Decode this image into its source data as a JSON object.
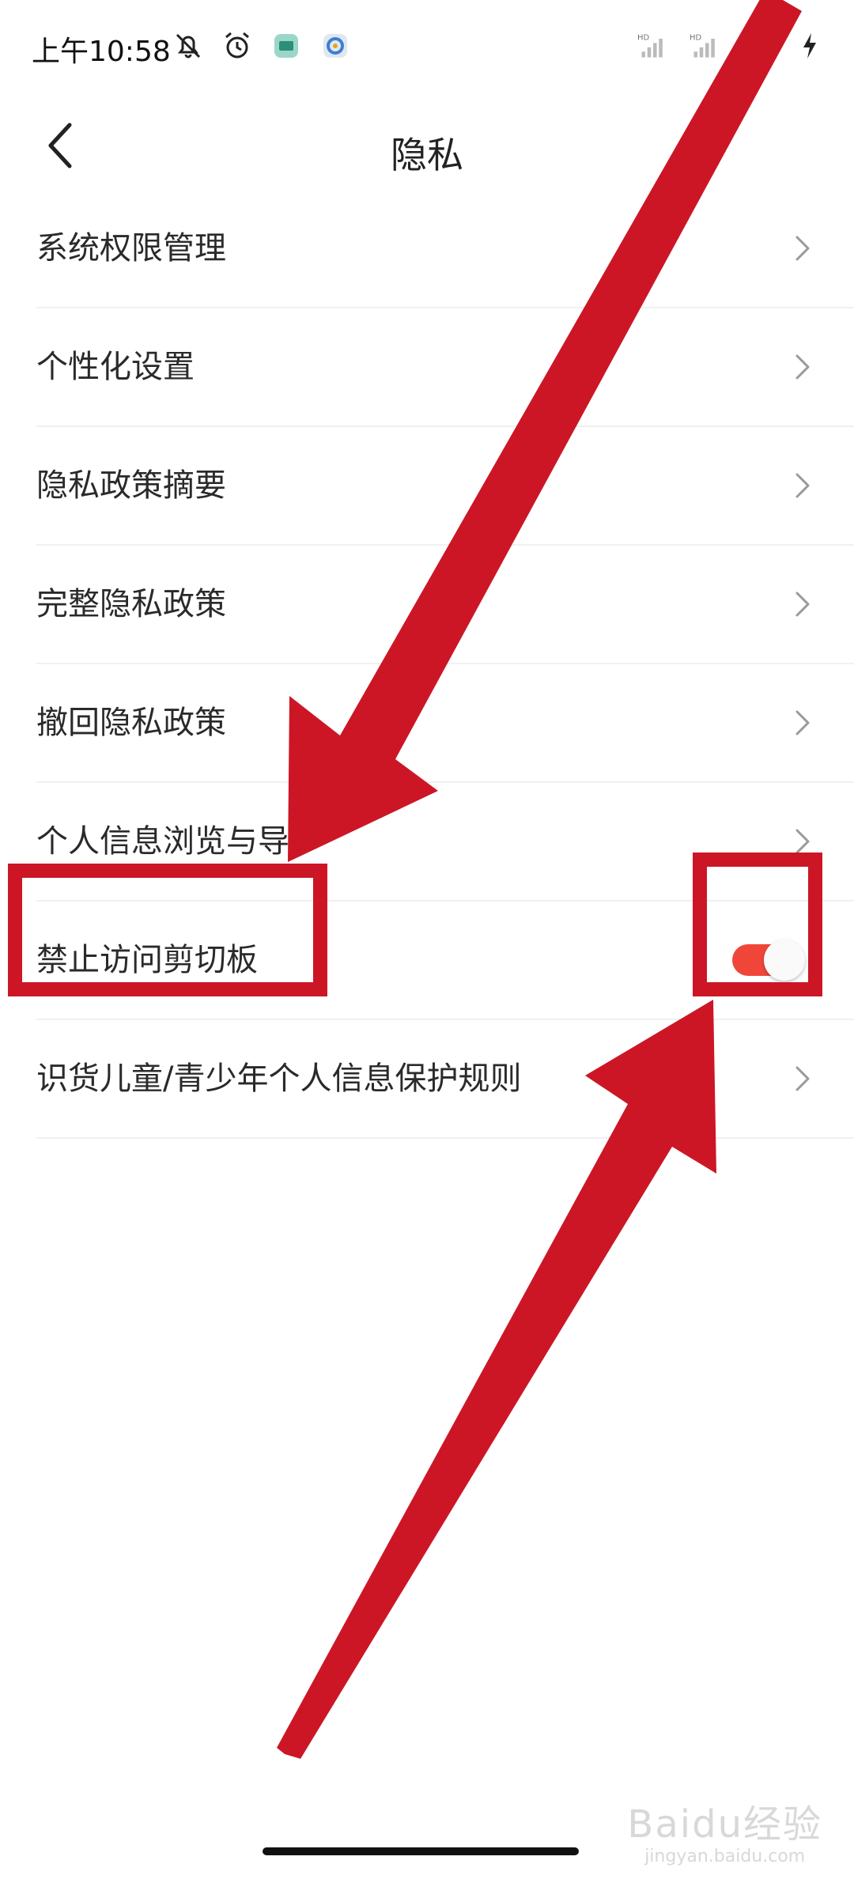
{
  "status_bar": {
    "time": "上午10:58",
    "icons_left": [
      "bell-off-icon",
      "alarm-icon",
      "app-notification-icon",
      "app-notification-icon"
    ],
    "icons_right": [
      "signal-hd-icon",
      "signal-hd-icon",
      "wifi-icon",
      "battery-charging-icon"
    ]
  },
  "header": {
    "title": "隐私",
    "back_icon": "chevron-left-icon"
  },
  "menu": {
    "items": [
      {
        "label": "系统权限管理",
        "type": "link"
      },
      {
        "label": "个性化设置",
        "type": "link"
      },
      {
        "label": "隐私政策摘要",
        "type": "link"
      },
      {
        "label": "完整隐私政策",
        "type": "link"
      },
      {
        "label": "撤回隐私政策",
        "type": "link"
      },
      {
        "label": "个人信息浏览与导",
        "type": "link"
      },
      {
        "label": "禁止访问剪切板",
        "type": "toggle",
        "on": true
      },
      {
        "label": "识货儿童/青少年个人信息保护规则",
        "type": "link"
      }
    ]
  },
  "colors": {
    "toggle_on": "#f0463a",
    "annotation_red": "#cc1626",
    "divider": "#f0f0f0",
    "chevron": "#9a9a9a"
  },
  "watermark": {
    "main": "Baidu经验",
    "sub": "jingyan.baidu.com"
  }
}
